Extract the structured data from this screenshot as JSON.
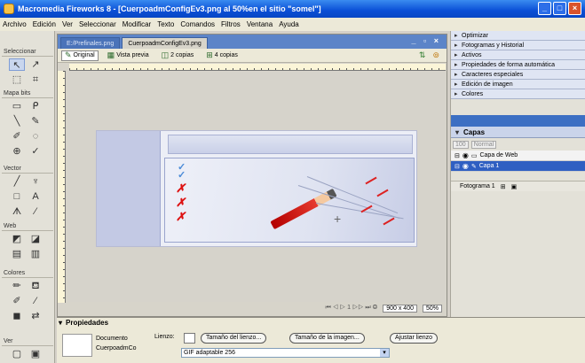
{
  "window": {
    "title": "Macromedia Fireworks 8 - [CuerpoadmConfigEv3.png al 50%en el sitio \"somel\"]"
  },
  "menubar": [
    "Archivo",
    "Edición",
    "Ver",
    "Seleccionar",
    "Modificar",
    "Texto",
    "Comandos",
    "Filtros",
    "Ventana",
    "Ayuda"
  ],
  "tools": {
    "sections": [
      "Seleccionar",
      "Mapa bits",
      "Vector",
      "Web",
      "Colores",
      "Ver"
    ]
  },
  "document": {
    "tabs": [
      "E:/Prefinales.png",
      "CuerpoadmConfigEv3.png"
    ],
    "view_buttons": [
      "Original",
      "Vista previa",
      "2 copias",
      "4 copias"
    ],
    "size": "900 x 400",
    "zoom": "50%"
  },
  "right_panels": {
    "items": [
      "Optimizar",
      "Fotogramas y Historial",
      "Activos",
      "Propiedades de forma automática",
      "Caracteres especiales",
      "Edición de imagen",
      "Colores"
    ],
    "layers_title": "Capas",
    "layer_mode": "Normal",
    "layers": [
      "Capa de Web",
      "Capa 1"
    ],
    "frame": "Fotograma 1"
  },
  "properties": {
    "title": "Propiedades",
    "doc_type": "Documento",
    "doc_name": "CuerpoadmCo",
    "canvas_label": "Lienzo:",
    "button_canvas_size": "Tamaño del lienzo...",
    "button_image_size": "Tamaño de la imagen...",
    "button_fit_canvas": "Ajustar lienzo",
    "format": "GIF adaptable 256"
  }
}
